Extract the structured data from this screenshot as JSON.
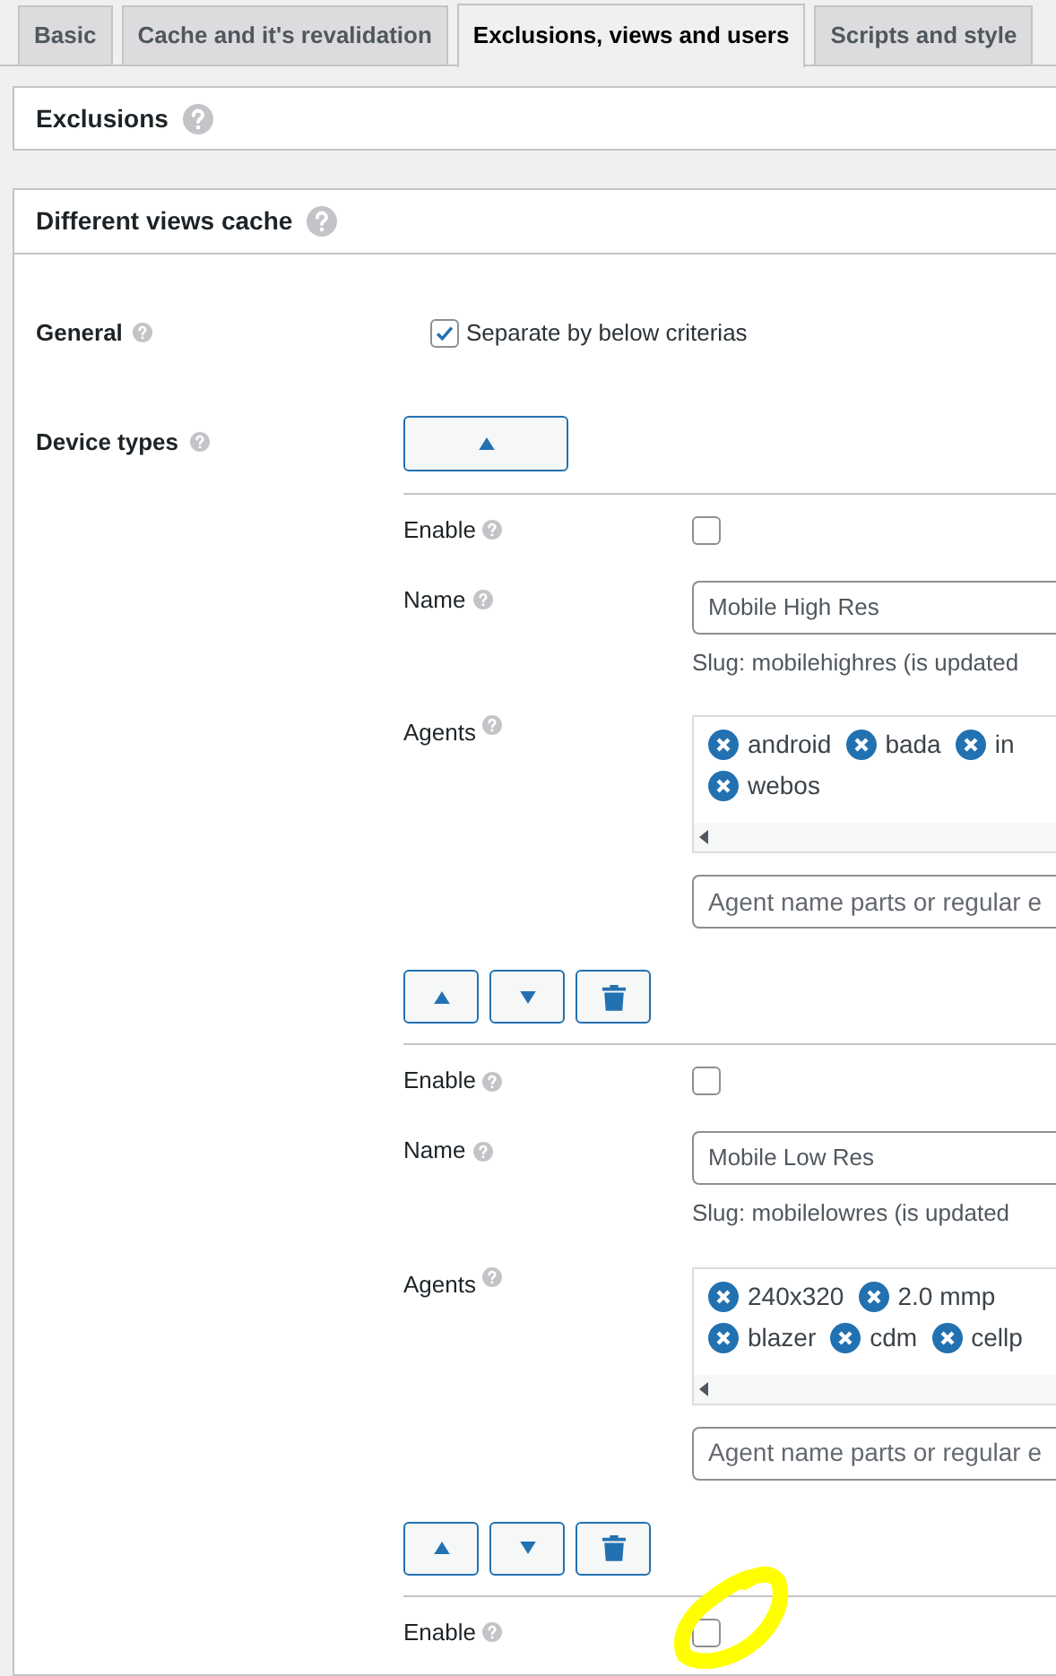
{
  "tabs": [
    {
      "label": "Basic",
      "selected": false
    },
    {
      "label": "Cache and it's revalidation",
      "selected": false
    },
    {
      "label": "Exclusions, views and users",
      "selected": true
    },
    {
      "label": "Scripts and style",
      "selected": false
    }
  ],
  "exclusions": {
    "title": "Exclusions"
  },
  "views": {
    "title": "Different views cache",
    "general": {
      "label": "General",
      "option": "Separate by below criterias",
      "checked": true
    },
    "device_types": {
      "label": "Device types",
      "expanded": true,
      "items": [
        {
          "enable_label": "Enable",
          "enabled": false,
          "name_label": "Name",
          "name_value": "Mobile High Res",
          "slug": "Slug: mobilehighres (is updated",
          "agents_label": "Agents",
          "agents": [
            [
              "android",
              "bada",
              "in"
            ],
            [
              "webos"
            ]
          ],
          "agent_placeholder": "Agent name parts or regular e"
        },
        {
          "enable_label": "Enable",
          "enabled": false,
          "name_label": "Name",
          "name_value": "Mobile Low Res",
          "slug": "Slug: mobilelowres (is updated",
          "agents_label": "Agents",
          "agents": [
            [
              "240x320",
              "2.0 mmp"
            ],
            [
              "blazer",
              "cdm",
              "cellp"
            ]
          ],
          "agent_placeholder": "Agent name parts or regular e"
        },
        {
          "enable_label": "Enable",
          "enabled": false
        }
      ]
    }
  }
}
